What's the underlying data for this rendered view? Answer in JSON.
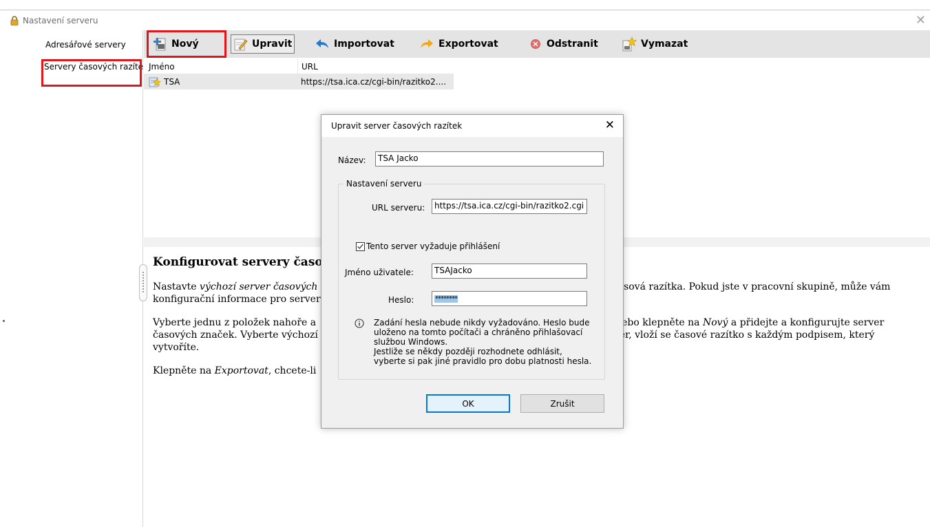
{
  "window": {
    "title": "Nastavení serveru",
    "icon": "lock-icon"
  },
  "sidebar": {
    "items": [
      {
        "label": "Adresářové servery"
      },
      {
        "label": "Servery časových razítek"
      }
    ]
  },
  "toolbar": {
    "new_label": "Nový",
    "edit_label": "Upravit",
    "import_label": "Importovat",
    "export_label": "Exportovat",
    "delete_label": "Odstranit",
    "clear_label": "Vymazat"
  },
  "table": {
    "columns": [
      "Jméno",
      "URL"
    ],
    "rows": [
      {
        "name": "TSA",
        "url": "https://tsa.ica.cz/cgi-bin/razitko2...."
      }
    ]
  },
  "help": {
    "heading": "Konfigurovat servery časov",
    "p1_a": "Nastavte ",
    "p1_em": "výchozí server časových ",
    "p1_b": "časová razítka. Pokud jste v pracovní skupině, může vám",
    "p1_c": "konfigurační informace pro server",
    "p2_a": "Vyberte jednu z položek nahoře a",
    "p2_b": "nebo klepněte na ",
    "p2_em": "Nový",
    "p2_c": " a přidejte a konfigurujte server",
    "p2_d": "časových značek. Vyberte výchozí",
    "p2_e": "ver, vloží se časové razítko s každým podpisem, který",
    "p2_f": "vytvoříte.",
    "p3_a": "Klepněte na ",
    "p3_em": "Exportovat",
    "p3_b": ", chcete-li"
  },
  "dialog": {
    "title": "Upravit server časových razítek",
    "name_label": "Název:",
    "name_value": "TSA Jacko",
    "group_title": "Nastavení serveru",
    "url_label": "URL serveru:",
    "url_value": "https://tsa.ica.cz/cgi-bin/razitko2.cgi",
    "login_checkbox_label": "Tento server vyžaduje přihlášení",
    "login_checked": true,
    "username_label": "Jméno uživatele:",
    "username_value": "TSAJacko",
    "password_label": "Heslo:",
    "password_value": "********",
    "info_lines": [
      "Zadání hesla nebude nikdy vyžadováno. Heslo bude",
      "uloženo na tomto počítači a chráněno přihlašovací",
      "službou Windows.",
      "Jestliže se někdy později rozhodnete odhlásit,",
      "vyberte si pak jiné pravidlo pro dobu platnosti hesla."
    ],
    "ok_label": "OK",
    "cancel_label": "Zrušit"
  },
  "colors": {
    "highlight_red": "#e0161a",
    "toolbar_bg": "#e4e4e4",
    "focus_blue": "#0078d7",
    "selection_blue": "#99c9ef"
  }
}
